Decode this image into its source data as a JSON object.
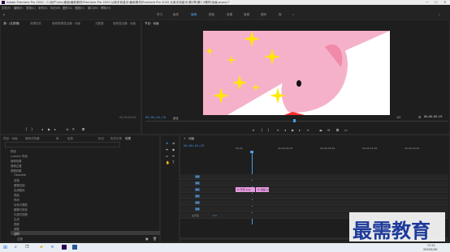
{
  "window": {
    "title": "Adobe Premiere Pro 2020 - C:\\用户\\hhx\\桌面\\最新素材\\Premiere Pro 2020 从新手到高手\\最新素材\\Premiere Pro 2020 从新手到高手\\第2章\\第2.3素材\\动画.prproj *",
    "minimize": "—",
    "maximize": "☐",
    "close": "✕"
  },
  "menu": [
    "文件(F)",
    "编辑(E)",
    "剪辑(C)",
    "序列(S)",
    "标记(M)",
    "图形(G)",
    "视图(V)",
    "窗口(W)",
    "帮助(H)"
  ],
  "workspaces": {
    "home_icon": "home-icon",
    "items": [
      "学习",
      "组件",
      "编辑",
      "颜色",
      "效果",
      "音频",
      "图形",
      "库"
    ],
    "active_index": 2
  },
  "source_panel": {
    "tabs": [
      "源：(无剪辑)",
      "效果控件",
      "音频剪辑混合器：动画",
      "元数据",
      "音频混合器：动画"
    ],
    "timecode": "00;00;00;00"
  },
  "program_panel": {
    "tabs": [
      "节目：动画"
    ],
    "timecode": "00;00;04;28",
    "fit": "适合",
    "quality": "1/2",
    "duration": "00;00;09;29",
    "canvas_colors": {
      "pink": "#f5b1c9",
      "star": "#ffe800",
      "white": "#ffffff"
    }
  },
  "project_panel": {
    "tabs": [
      "项目：动画",
      "媒体浏览器",
      "库",
      "信息",
      "效果",
      "标记",
      "历史记录"
    ],
    "items": [
      "预设",
      "Lumetri 预设",
      "音频效果",
      "音频过渡",
      "视频效果",
      "Obsolete",
      "变换",
      "图像控制",
      "实用程序",
      "扭曲",
      "时间",
      "杂色与颗粒",
      "模糊与锐化",
      "沉浸式视频",
      "生成",
      "视频",
      "调整",
      "过时",
      "过渡",
      "透视"
    ],
    "selected_item": "变换"
  },
  "timeline": {
    "tab": "动画",
    "timecode": "00;00;04;28",
    "ruler": [
      "00;00",
      "00;00;04;29",
      "00;00;09;29",
      "00;00;14;29",
      "00;00;19;29"
    ],
    "video_tracks": [
      "V3",
      "V2",
      "V1"
    ],
    "audio_tracks": [
      "A1",
      "A2",
      "A3"
    ],
    "master": "主声道",
    "master_value": "0.0",
    "clips": [
      {
        "track": "V1",
        "label": "fx 背景.png"
      },
      {
        "track": "V1",
        "label": "fx 动画.png"
      }
    ]
  },
  "taskbar": {
    "time": "17:21",
    "date": "2020/1/30",
    "icons": [
      "windows-icon",
      "search-icon",
      "taskview-icon",
      "folder-icon",
      "edge-icon",
      "premiere-icon",
      "word-icon"
    ]
  },
  "watermark": "最需教育"
}
